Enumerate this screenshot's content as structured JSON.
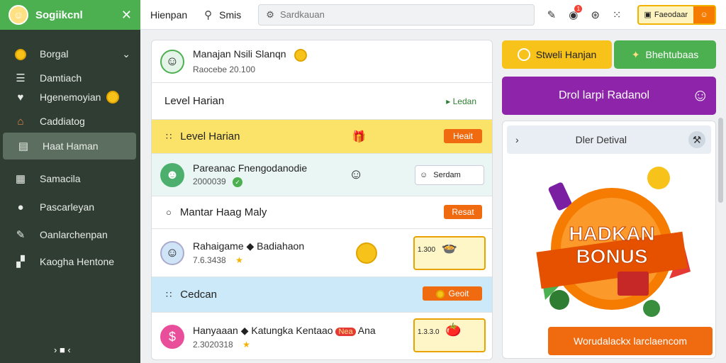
{
  "sidebar": {
    "title": "Sogiikcnl",
    "items": [
      {
        "label": "Borgal",
        "icon": "coin-icon"
      },
      {
        "label": "Damtiach",
        "icon": "list-icon"
      },
      {
        "label": "Hgenemoyian",
        "icon": "heart-icon"
      },
      {
        "label": "Caddiatog",
        "icon": "house-icon"
      },
      {
        "label": "Haat Haman",
        "icon": "clipboard-icon"
      },
      {
        "label": "Samacila",
        "icon": "document-icon"
      },
      {
        "label": "Pascarleyan",
        "icon": "person-icon"
      },
      {
        "label": "Oanlarchenpan",
        "icon": "pencil-icon"
      },
      {
        "label": "Kaogha Hentone",
        "icon": "grid-icon"
      }
    ]
  },
  "topbar": {
    "title": "Hienpan",
    "search_label": "Smis",
    "search_placeholder": "Sardkauan",
    "notif_count": "1",
    "button_label": "Faeodaar"
  },
  "main": {
    "header_name": "Manajan Nsili Slanqn",
    "header_sub": "Raocebe 20.100",
    "level1": "Level Harian",
    "level1_link": "Ledan",
    "section1": "Level Harian",
    "section1_btn": "Heait",
    "row1_name": "Pareanac Fnengodanodie",
    "row1_sub": "2000039",
    "row1_chip": "Serdam",
    "section2": "Mantar Haag Maly",
    "section2_btn": "Resat",
    "row2_name": "Rahaigame",
    "row2_extra": "Badiahaon",
    "row2_sub": "7.6.3438",
    "row2_prize": "1.300",
    "section3": "Cedcan",
    "section3_btn": "Geoit",
    "row3_name": "Hanyaaan",
    "row3_extra": "Katungka Kentaao",
    "row3_tag": "Nea",
    "row3_extra2": "Ana",
    "row3_sub": "2.3020318",
    "row3_prize": "1.3.3.0"
  },
  "right": {
    "btn1": "Stweli Hanjan",
    "btn2": "Bhehtubaas",
    "promo": "Drol larpi Radanol",
    "panel_title": "Dler Detival",
    "bonus_line1": "HADKAN",
    "bonus_line2": "BONUS",
    "panel_button": "Worudalackx larclaencom"
  },
  "colors": {
    "green": "#4caf50",
    "orange": "#f06a10",
    "purple": "#8e24aa",
    "yellow": "#f7c21a"
  }
}
